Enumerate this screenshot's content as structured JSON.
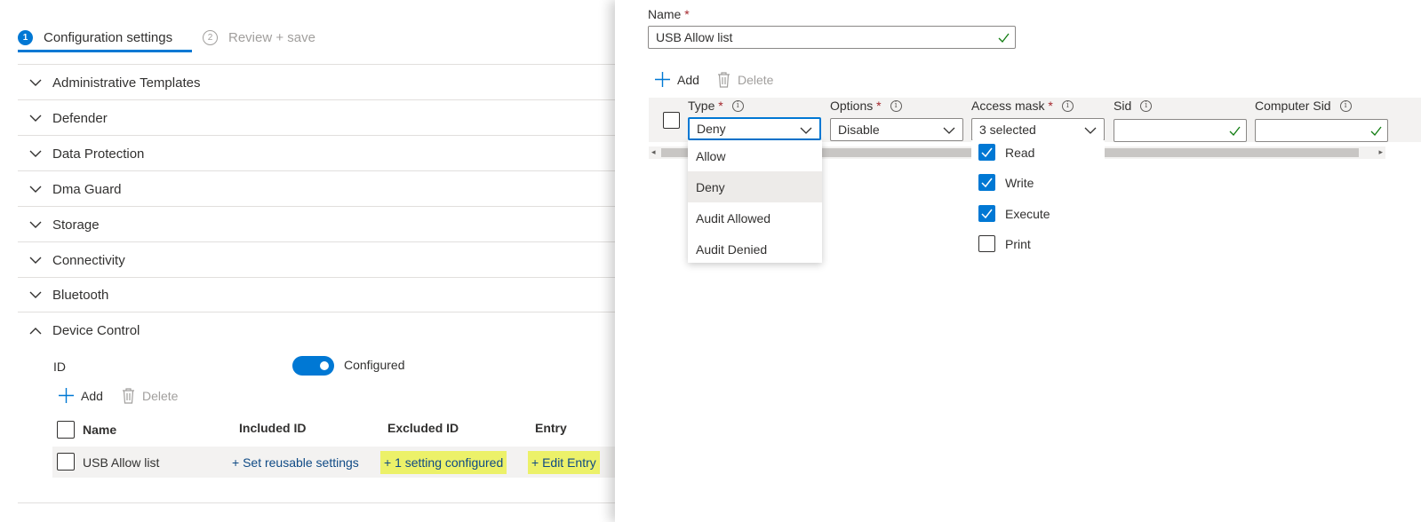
{
  "wizard": {
    "steps": [
      {
        "num": "1",
        "label": "Configuration settings"
      },
      {
        "num": "2",
        "label": "Review + save"
      }
    ]
  },
  "sections": [
    {
      "label": "Administrative Templates"
    },
    {
      "label": "Defender"
    },
    {
      "label": "Data Protection"
    },
    {
      "label": "Dma Guard"
    },
    {
      "label": "Storage"
    },
    {
      "label": "Connectivity"
    },
    {
      "label": "Bluetooth"
    },
    {
      "label": "Device Control"
    }
  ],
  "device_control": {
    "id_label": "ID",
    "toggle_state": "Configured",
    "toolbar": {
      "add": "Add",
      "delete": "Delete"
    },
    "table": {
      "headers": [
        "Name",
        "Included ID",
        "Excluded ID",
        "Entry"
      ],
      "row": {
        "name": "USB Allow list",
        "included": "+ Set reusable settings",
        "excluded": "+ 1 setting configured",
        "entry": "+ Edit Entry"
      }
    }
  },
  "panel": {
    "name_label": "Name",
    "required_mark": "*",
    "name_value": "USB Allow list",
    "toolbar": {
      "add": "Add",
      "delete": "Delete"
    },
    "columns": [
      {
        "label": "Type",
        "required": true
      },
      {
        "label": "Options",
        "required": true
      },
      {
        "label": "Access mask",
        "required": true
      },
      {
        "label": "Sid",
        "required": false
      },
      {
        "label": "Computer Sid",
        "required": false
      }
    ],
    "type_value": "Deny",
    "options_value": "Disable",
    "access_mask_value": "3 selected",
    "sid_value": "",
    "computer_sid_value": "",
    "type_options": [
      "Allow",
      "Deny",
      "Audit Allowed",
      "Audit Denied"
    ],
    "access_mask_options": [
      {
        "label": "Read",
        "checked": true
      },
      {
        "label": "Write",
        "checked": true
      },
      {
        "label": "Execute",
        "checked": true
      },
      {
        "label": "Print",
        "checked": false
      }
    ]
  },
  "colors": {
    "accent": "#0078d4",
    "highlight": "#ecf169",
    "required": "#a4262c",
    "valid": "#107c10"
  }
}
